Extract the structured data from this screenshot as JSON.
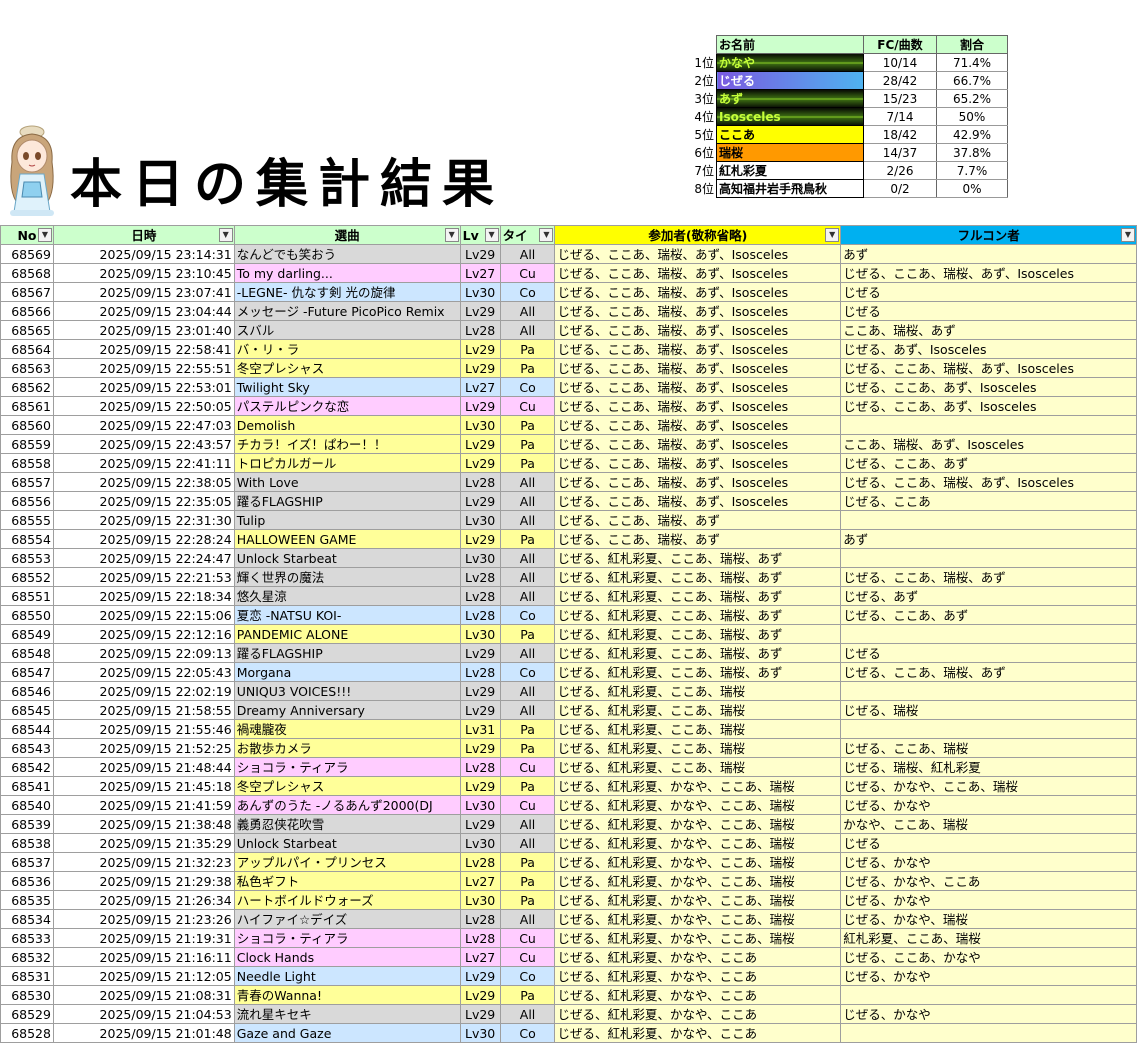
{
  "title": "本日の集計結果",
  "ranking": {
    "headers": [
      "お名前",
      "FC/曲数",
      "割合"
    ],
    "rows": [
      {
        "rank": "1位",
        "name": "かなや",
        "fc": "10/14",
        "pct": "71.4%",
        "bg": "#1f2a10",
        "fg": "#c6ff3a"
      },
      {
        "rank": "2位",
        "name": "じぜる",
        "fc": "28/42",
        "pct": "66.7%",
        "bg": "#8a6fe8",
        "fg": "#ffffff"
      },
      {
        "rank": "3位",
        "name": "あず",
        "fc": "15/23",
        "pct": "65.2%",
        "bg": "#1f2a10",
        "fg": "#c6ff3a"
      },
      {
        "rank": "4位",
        "name": "Isosceles",
        "fc": "7/14",
        "pct": "50%",
        "bg": "#1f2a10",
        "fg": "#c6ff3a"
      },
      {
        "rank": "5位",
        "name": "ここあ",
        "fc": "18/42",
        "pct": "42.9%",
        "bg": "#ffff00",
        "fg": "#000000"
      },
      {
        "rank": "6位",
        "name": "瑞桜",
        "fc": "14/37",
        "pct": "37.8%",
        "bg": "#ff9900",
        "fg": "#000000"
      },
      {
        "rank": "7位",
        "name": "紅札彩夏",
        "fc": "2/26",
        "pct": "7.7%",
        "bg": "#ffffff",
        "fg": "#000000"
      },
      {
        "rank": "8位",
        "name": "高知福井岩手飛鳥秋",
        "fc": "0/2",
        "pct": "0%",
        "bg": "#ffffff",
        "fg": "#000000"
      }
    ]
  },
  "grid": {
    "headers": {
      "no": "No",
      "datetime": "日時",
      "song": "選曲",
      "lv": "Lv",
      "type": "タイ",
      "participants": "参加者(敬称省略)",
      "fullcombo": "フルコン者"
    },
    "type_colors": {
      "All": "#d9d9d9",
      "Cu": "#ffccff",
      "Pa": "#ffff99",
      "Co": "#cce6ff"
    },
    "rows": [
      [
        "68569",
        "2025/09/15 23:14:31",
        "なんどでも笑おう",
        "Lv29",
        "All",
        "じぜる、ここあ、瑞桜、あず、Isosceles",
        "あず"
      ],
      [
        "68568",
        "2025/09/15 23:10:45",
        "To my darling...",
        "Lv27",
        "Cu",
        "じぜる、ここあ、瑞桜、あず、Isosceles",
        "じぜる、ここあ、瑞桜、あず、Isosceles"
      ],
      [
        "68567",
        "2025/09/15 23:07:41",
        "-LEGNE- 仇なす剣 光の旋律",
        "Lv30",
        "Co",
        "じぜる、ここあ、瑞桜、あず、Isosceles",
        "じぜる"
      ],
      [
        "68566",
        "2025/09/15 23:04:44",
        "メッセージ -Future PicoPico Remix",
        "Lv29",
        "All",
        "じぜる、ここあ、瑞桜、あず、Isosceles",
        "じぜる"
      ],
      [
        "68565",
        "2025/09/15 23:01:40",
        "スバル",
        "Lv28",
        "All",
        "じぜる、ここあ、瑞桜、あず、Isosceles",
        "ここあ、瑞桜、あず"
      ],
      [
        "68564",
        "2025/09/15 22:58:41",
        "バ・リ・ラ",
        "Lv29",
        "Pa",
        "じぜる、ここあ、瑞桜、あず、Isosceles",
        "じぜる、あず、Isosceles"
      ],
      [
        "68563",
        "2025/09/15 22:55:51",
        "冬空プレシャス",
        "Lv29",
        "Pa",
        "じぜる、ここあ、瑞桜、あず、Isosceles",
        "じぜる、ここあ、瑞桜、あず、Isosceles"
      ],
      [
        "68562",
        "2025/09/15 22:53:01",
        "Twilight Sky",
        "Lv27",
        "Co",
        "じぜる、ここあ、瑞桜、あず、Isosceles",
        "じぜる、ここあ、あず、Isosceles"
      ],
      [
        "68561",
        "2025/09/15 22:50:05",
        "パステルピンクな恋",
        "Lv29",
        "Cu",
        "じぜる、ここあ、瑞桜、あず、Isosceles",
        "じぜる、ここあ、あず、Isosceles"
      ],
      [
        "68560",
        "2025/09/15 22:47:03",
        "Demolish",
        "Lv30",
        "Pa",
        "じぜる、ここあ、瑞桜、あず、Isosceles",
        ""
      ],
      [
        "68559",
        "2025/09/15 22:43:57",
        "チカラ！イズ！ぱわー！！",
        "Lv29",
        "Pa",
        "じぜる、ここあ、瑞桜、あず、Isosceles",
        "ここあ、瑞桜、あず、Isosceles"
      ],
      [
        "68558",
        "2025/09/15 22:41:11",
        "トロピカルガール",
        "Lv29",
        "Pa",
        "じぜる、ここあ、瑞桜、あず、Isosceles",
        "じぜる、ここあ、あず"
      ],
      [
        "68557",
        "2025/09/15 22:38:05",
        "With Love",
        "Lv28",
        "All",
        "じぜる、ここあ、瑞桜、あず、Isosceles",
        "じぜる、ここあ、瑞桜、あず、Isosceles"
      ],
      [
        "68556",
        "2025/09/15 22:35:05",
        "躍るFLAGSHIP",
        "Lv29",
        "All",
        "じぜる、ここあ、瑞桜、あず、Isosceles",
        "じぜる、ここあ"
      ],
      [
        "68555",
        "2025/09/15 22:31:30",
        "Tulip",
        "Lv30",
        "All",
        "じぜる、ここあ、瑞桜、あず",
        ""
      ],
      [
        "68554",
        "2025/09/15 22:28:24",
        "HALLOWEEN GAME",
        "Lv29",
        "Pa",
        "じぜる、ここあ、瑞桜、あず",
        "あず"
      ],
      [
        "68553",
        "2025/09/15 22:24:47",
        "Unlock Starbeat",
        "Lv30",
        "All",
        "じぜる、紅札彩夏、ここあ、瑞桜、あず",
        ""
      ],
      [
        "68552",
        "2025/09/15 22:21:53",
        "輝く世界の魔法",
        "Lv28",
        "All",
        "じぜる、紅札彩夏、ここあ、瑞桜、あず",
        "じぜる、ここあ、瑞桜、あず"
      ],
      [
        "68551",
        "2025/09/15 22:18:34",
        "悠久星涼",
        "Lv28",
        "All",
        "じぜる、紅札彩夏、ここあ、瑞桜、あず",
        "じぜる、あず"
      ],
      [
        "68550",
        "2025/09/15 22:15:06",
        "夏恋 -NATSU KOI-",
        "Lv28",
        "Co",
        "じぜる、紅札彩夏、ここあ、瑞桜、あず",
        "じぜる、ここあ、あず"
      ],
      [
        "68549",
        "2025/09/15 22:12:16",
        "PANDEMIC ALONE",
        "Lv30",
        "Pa",
        "じぜる、紅札彩夏、ここあ、瑞桜、あず",
        ""
      ],
      [
        "68548",
        "2025/09/15 22:09:13",
        "躍るFLAGSHIP",
        "Lv29",
        "All",
        "じぜる、紅札彩夏、ここあ、瑞桜、あず",
        "じぜる"
      ],
      [
        "68547",
        "2025/09/15 22:05:43",
        "Morgana",
        "Lv28",
        "Co",
        "じぜる、紅札彩夏、ここあ、瑞桜、あず",
        "じぜる、ここあ、瑞桜、あず"
      ],
      [
        "68546",
        "2025/09/15 22:02:19",
        "UNIQU3 VOICES!!!",
        "Lv29",
        "All",
        "じぜる、紅札彩夏、ここあ、瑞桜",
        ""
      ],
      [
        "68545",
        "2025/09/15 21:58:55",
        "Dreamy Anniversary",
        "Lv29",
        "All",
        "じぜる、紅札彩夏、ここあ、瑞桜",
        "じぜる、瑞桜"
      ],
      [
        "68544",
        "2025/09/15 21:55:46",
        "禍魂朧夜",
        "Lv31",
        "Pa",
        "じぜる、紅札彩夏、ここあ、瑞桜",
        ""
      ],
      [
        "68543",
        "2025/09/15 21:52:25",
        "お散歩カメラ",
        "Lv29",
        "Pa",
        "じぜる、紅札彩夏、ここあ、瑞桜",
        "じぜる、ここあ、瑞桜"
      ],
      [
        "68542",
        "2025/09/15 21:48:44",
        "ショコラ・ティアラ",
        "Lv28",
        "Cu",
        "じぜる、紅札彩夏、ここあ、瑞桜",
        "じぜる、瑞桜、紅札彩夏"
      ],
      [
        "68541",
        "2025/09/15 21:45:18",
        "冬空プレシャス",
        "Lv29",
        "Pa",
        "じぜる、紅札彩夏、かなや、ここあ、瑞桜",
        "じぜる、かなや、ここあ、瑞桜"
      ],
      [
        "68540",
        "2025/09/15 21:41:59",
        "あんずのうた -ノるあんず2000(DJ",
        "Lv30",
        "Cu",
        "じぜる、紅札彩夏、かなや、ここあ、瑞桜",
        "じぜる、かなや"
      ],
      [
        "68539",
        "2025/09/15 21:38:48",
        "義勇忍侠花吹雪",
        "Lv29",
        "All",
        "じぜる、紅札彩夏、かなや、ここあ、瑞桜",
        "かなや、ここあ、瑞桜"
      ],
      [
        "68538",
        "2025/09/15 21:35:29",
        "Unlock Starbeat",
        "Lv30",
        "All",
        "じぜる、紅札彩夏、かなや、ここあ、瑞桜",
        "じぜる"
      ],
      [
        "68537",
        "2025/09/15 21:32:23",
        "アップルパイ・プリンセス",
        "Lv28",
        "Pa",
        "じぜる、紅札彩夏、かなや、ここあ、瑞桜",
        "じぜる、かなや"
      ],
      [
        "68536",
        "2025/09/15 21:29:38",
        "私色ギフト",
        "Lv27",
        "Pa",
        "じぜる、紅札彩夏、かなや、ここあ、瑞桜",
        "じぜる、かなや、ここあ"
      ],
      [
        "68535",
        "2025/09/15 21:26:34",
        "ハートボイルドウォーズ",
        "Lv30",
        "Pa",
        "じぜる、紅札彩夏、かなや、ここあ、瑞桜",
        "じぜる、かなや"
      ],
      [
        "68534",
        "2025/09/15 21:23:26",
        "ハイファイ☆デイズ",
        "Lv28",
        "All",
        "じぜる、紅札彩夏、かなや、ここあ、瑞桜",
        "じぜる、かなや、瑞桜"
      ],
      [
        "68533",
        "2025/09/15 21:19:31",
        "ショコラ・ティアラ",
        "Lv28",
        "Cu",
        "じぜる、紅札彩夏、かなや、ここあ、瑞桜",
        "紅札彩夏、ここあ、瑞桜"
      ],
      [
        "68532",
        "2025/09/15 21:16:11",
        "Clock Hands",
        "Lv27",
        "Cu",
        "じぜる、紅札彩夏、かなや、ここあ",
        "じぜる、ここあ、かなや"
      ],
      [
        "68531",
        "2025/09/15 21:12:05",
        "Needle Light",
        "Lv29",
        "Co",
        "じぜる、紅札彩夏、かなや、ここあ",
        "じぜる、かなや"
      ],
      [
        "68530",
        "2025/09/15 21:08:31",
        "青春のWanna!",
        "Lv29",
        "Pa",
        "じぜる、紅札彩夏、かなや、ここあ",
        ""
      ],
      [
        "68529",
        "2025/09/15 21:04:53",
        "流れ星キセキ",
        "Lv29",
        "All",
        "じぜる、紅札彩夏、かなや、ここあ",
        "じぜる、かなや"
      ],
      [
        "68528",
        "2025/09/15 21:01:48",
        "Gaze and Gaze",
        "Lv30",
        "Co",
        "じぜる、紅札彩夏、かなや、ここあ",
        ""
      ]
    ]
  }
}
